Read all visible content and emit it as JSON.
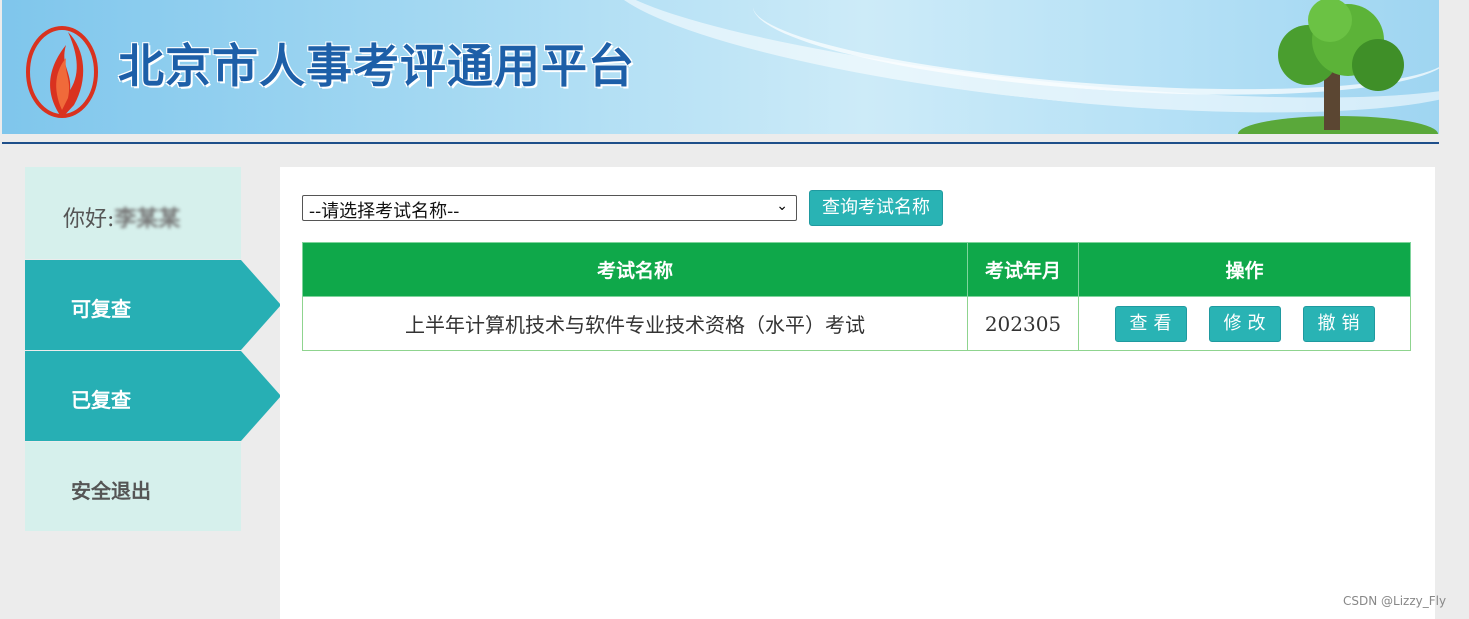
{
  "header": {
    "site_title": "北京市人事考评通用平台"
  },
  "sidebar": {
    "greeting_prefix": "你好:",
    "username": "李某某",
    "items": [
      {
        "label": "可复查",
        "active": true
      },
      {
        "label": "已复查",
        "active": true
      },
      {
        "label": "安全退出",
        "active": false
      }
    ]
  },
  "filter": {
    "select_value": "--请选择考试名称--",
    "query_button": "查询考试名称"
  },
  "table": {
    "headers": [
      "考试名称",
      "考试年月",
      "操作"
    ],
    "rows": [
      {
        "exam_name": "上半年计算机技术与软件专业技术资格（水平）考试",
        "exam_date": "202305",
        "actions": [
          "查看",
          "修改",
          "撤销"
        ]
      }
    ]
  },
  "watermark": "CSDN @Lizzy_Fly",
  "colors": {
    "accent_teal": "#27afb4",
    "header_green": "#0fa84a",
    "title_blue": "#1d5fa8"
  }
}
